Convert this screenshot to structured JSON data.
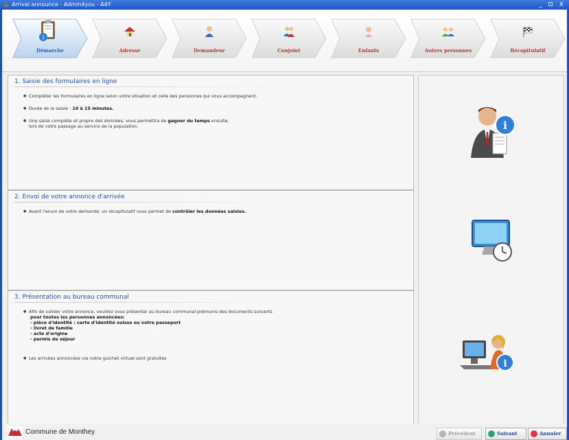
{
  "window": {
    "title": "Arrival announce - Admin4you - A4Y",
    "controls": "_ ⊡ X"
  },
  "steps": [
    {
      "label": "Démarche",
      "icon": "clipboard-info-icon",
      "active": true
    },
    {
      "label": "Adresse",
      "icon": "house-icon",
      "active": false
    },
    {
      "label": "Demandeur",
      "icon": "person-icon",
      "active": false
    },
    {
      "label": "Conjoint",
      "icon": "couple-icon",
      "active": false
    },
    {
      "label": "Enfants",
      "icon": "child-icon",
      "active": false
    },
    {
      "label": "Autres personnes",
      "icon": "group-icon",
      "active": false
    },
    {
      "label": "Récapitulatif",
      "icon": "checkered-flag-icon",
      "active": false
    }
  ],
  "sections": {
    "s1": {
      "title": "1. Saisie des formulaires en ligne",
      "b1": "Compléter les formulaires en ligne selon votre situation et celle des personnes qui vous accompagnent.",
      "b2_pre": "Durée de la saisie : ",
      "b2_bold": "10 à 15 minutes.",
      "b3_pre": "Une saise complète et propre des données, vous permettra de ",
      "b3_bold": "gagner du temps",
      "b3_post": " ensuite,",
      "b3_line2": "lors de votre passage au service de la population."
    },
    "s2": {
      "title": "2. Envoi de votre annonce d'arrivée",
      "b1_pre": "Avant l'envoi de votre demande, un récapitulatif vous permet de ",
      "b1_bold": "contrôler les données saisies."
    },
    "s3": {
      "title": "3. Présentation au bureau communal",
      "b1": "Afin de valider votre annonce, veuillez vous présenter au bureau communal prémunis des documents suivants",
      "l1": "pour toutes les personnes annoncées:",
      "l2": "- pièce d'identité : carte d'identité suisse ou votre passeport",
      "l3": " - livret de famille",
      "l4": " - acte d'origine",
      "l5": " - permis de séjour",
      "b2": "Les arrivées annoncées via notre guichet virtuel sont gratuites"
    }
  },
  "footer": {
    "commune": "Commune de Monthey",
    "prev": "Précédent",
    "next": "Suivant",
    "cancel": "Annuler"
  },
  "colors": {
    "accent": "#1d5fb8",
    "step_label": "#c0392b",
    "section_title": "#2150a8",
    "frame": "#1e4fb0"
  }
}
